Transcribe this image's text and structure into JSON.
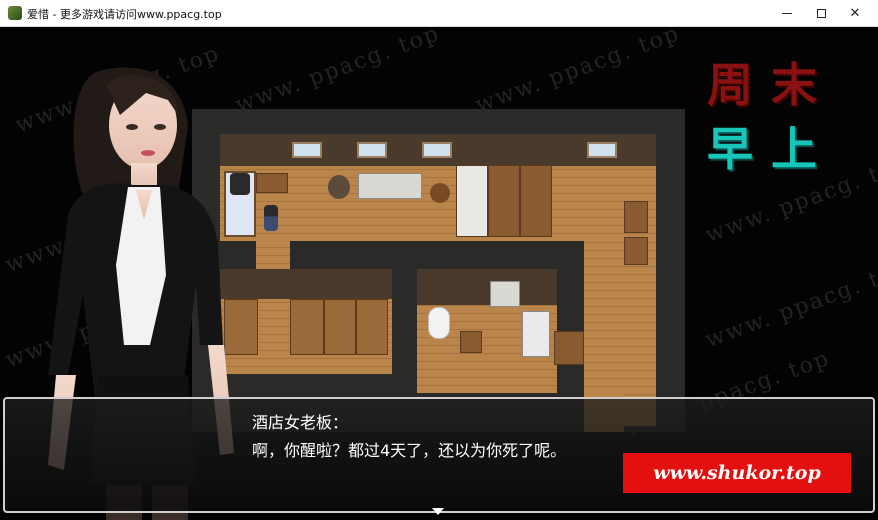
{
  "window": {
    "title": "爱惜 - 更多游戏请访问www.ppacg.top",
    "minimize_glyph": "—",
    "maximize_glyph": "☐",
    "close_glyph": "✕"
  },
  "overlay": {
    "watermark": "www. ppacg. top",
    "site_badge": "www.shukor.top"
  },
  "hud": {
    "day": "周末",
    "time": "早上"
  },
  "dialog": {
    "speaker": "酒店女老板：",
    "text": "啊，你醒啦？都过4天了，还以为你死了呢。"
  },
  "colors": {
    "day_sign": "#8b1010",
    "time_sign": "#17c6b8",
    "badge": "#e41010"
  }
}
